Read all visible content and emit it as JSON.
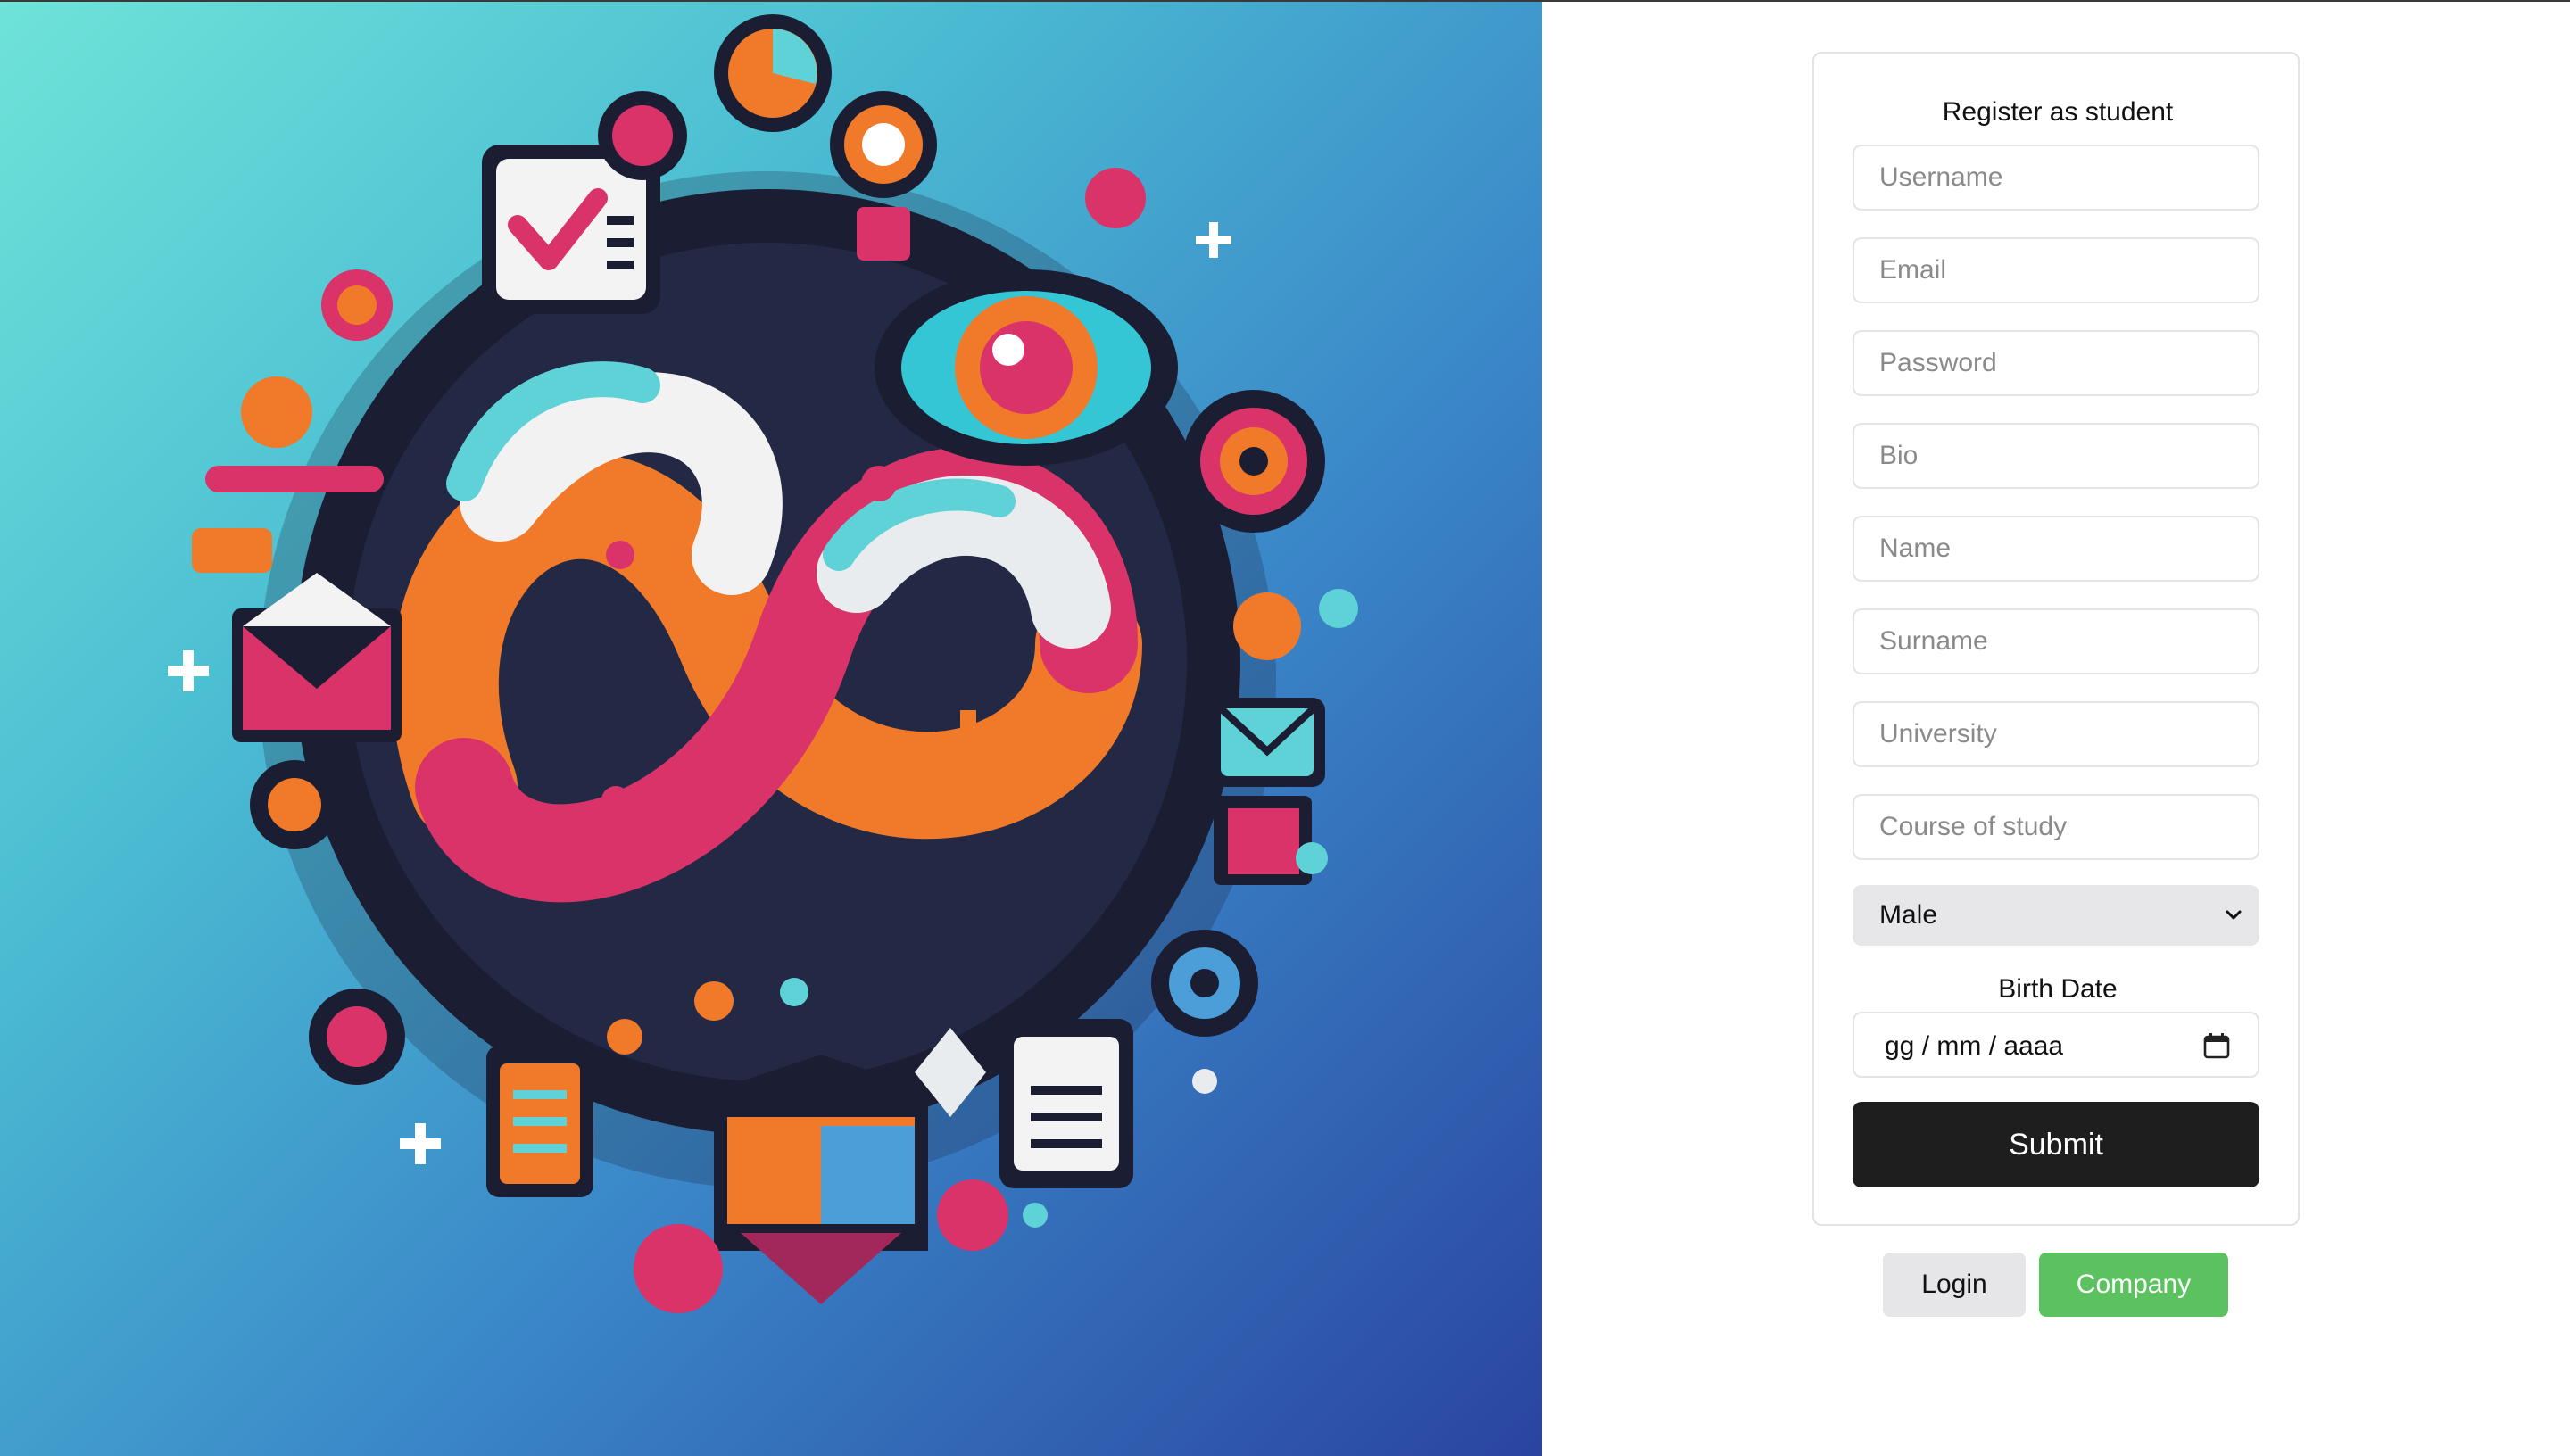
{
  "form": {
    "title": "Register as student",
    "fields": [
      {
        "placeholder": "Username"
      },
      {
        "placeholder": "Email"
      },
      {
        "placeholder": "Password"
      },
      {
        "placeholder": "Bio"
      },
      {
        "placeholder": "Name"
      },
      {
        "placeholder": "Surname"
      },
      {
        "placeholder": "University"
      },
      {
        "placeholder": "Course of study"
      }
    ],
    "gender_select": {
      "selected": "Male"
    },
    "birth_date": {
      "label": "Birth Date",
      "placeholder": "gg / mm / aaaa"
    },
    "submit_label": "Submit"
  },
  "footer": {
    "login_label": "Login",
    "company_label": "Company"
  },
  "colors": {
    "submit_bg": "#1e1e1e",
    "company_bg": "#5cc25f",
    "login_bg": "#e6e6e8"
  },
  "icons": {
    "select": "chevron-down-icon",
    "date": "calendar-icon"
  }
}
